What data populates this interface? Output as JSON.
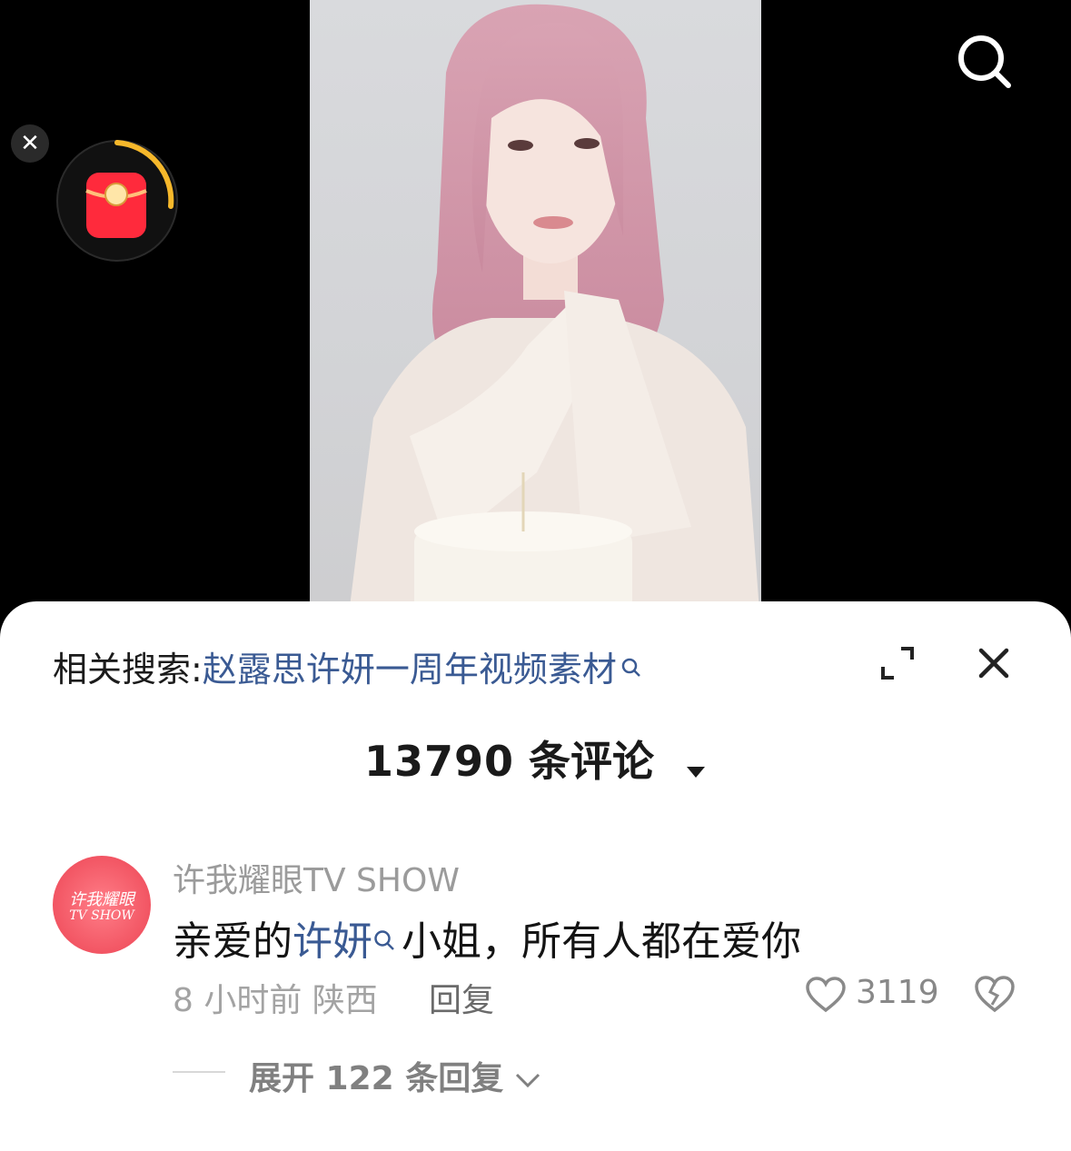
{
  "video": {
    "icons": {
      "search": "search-icon",
      "close": "close-icon",
      "redpacket": "red-envelope-icon"
    },
    "accent_colors": {
      "ring": "#f6b82b",
      "envelope": "#ff2a3c"
    }
  },
  "sheet": {
    "related_label": "相关搜索:",
    "related_keyword": "赵露思许妍一周年视频素材",
    "comment_count": "13790",
    "comment_count_suffix": "条评论"
  },
  "comments": [
    {
      "avatar_text_1": "许我耀眼",
      "avatar_text_2": "TV SHOW",
      "username": "许我耀眼TV SHOW",
      "text_before": "亲爱的",
      "text_highlight": "许妍",
      "text_after": "小姐，所有人都在爱你",
      "time_location": "8 小时前 陕西",
      "reply_label": "回复",
      "likes": "3119",
      "expand_label": "展开 122 条回复"
    }
  ],
  "colors": {
    "link": "#3a5a93",
    "muted": "#9b9b9b"
  }
}
